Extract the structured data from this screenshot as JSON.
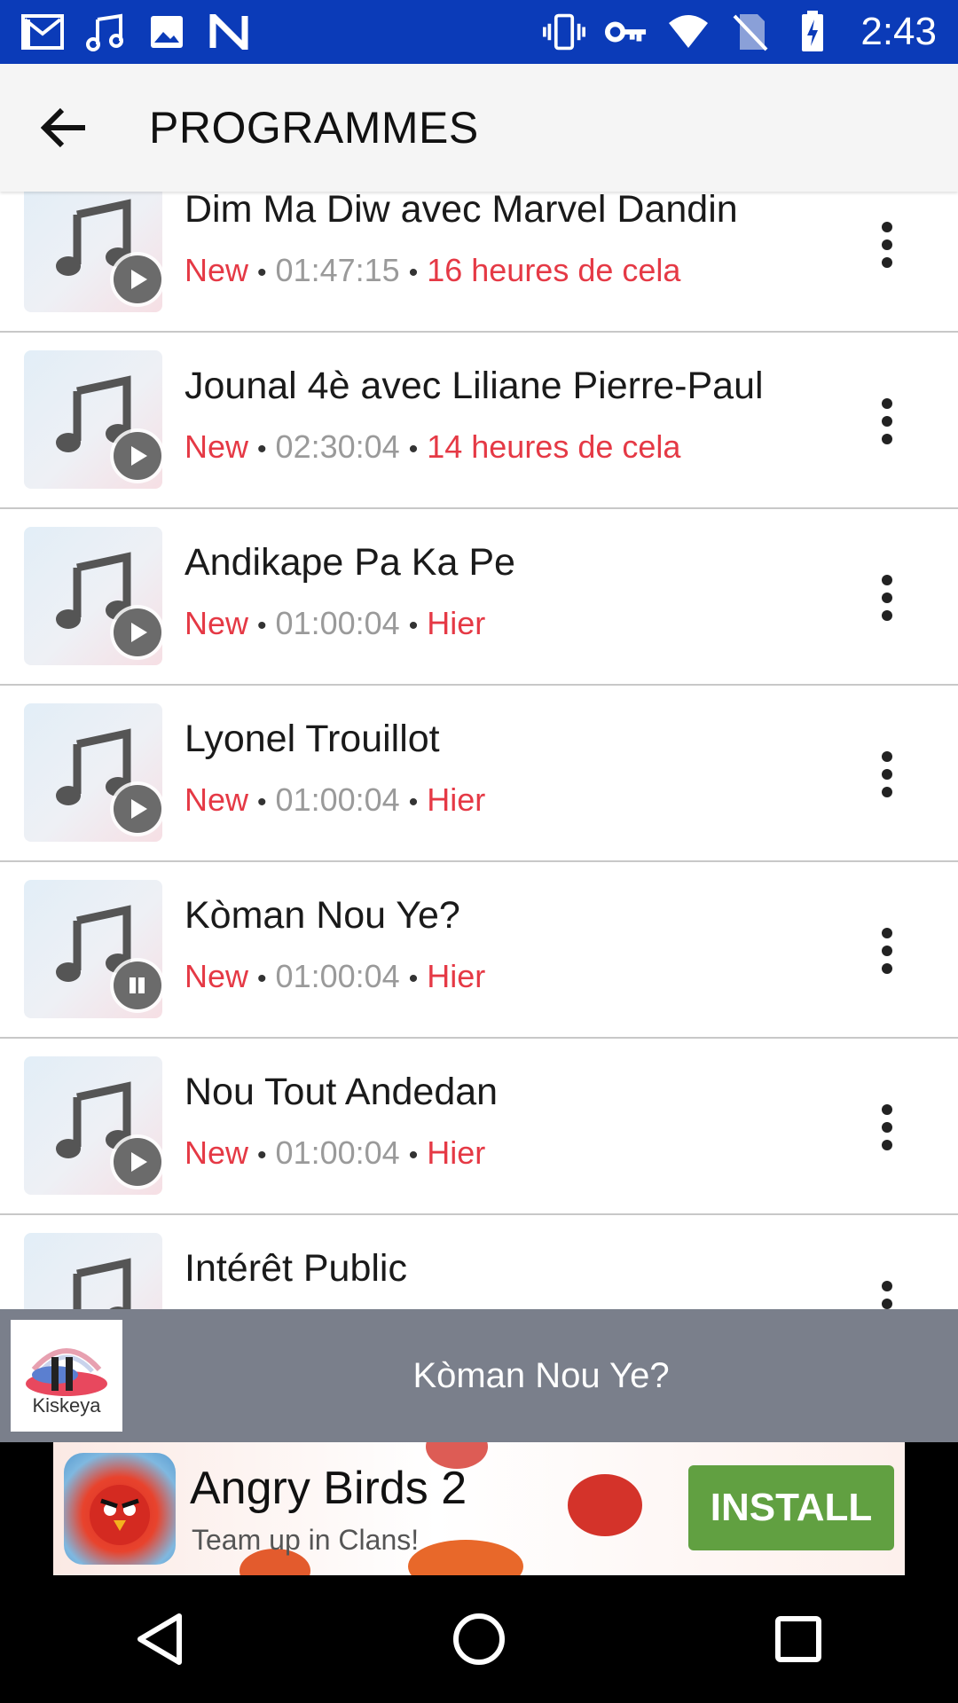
{
  "status_bar": {
    "time": "2:43",
    "left_icons": [
      "gmail-icon",
      "music-note-icon",
      "image-icon",
      "n-logo-icon"
    ],
    "right_icons": [
      "vibrate-icon",
      "vpn-key-icon",
      "wifi-icon",
      "no-sim-icon",
      "battery-charging-icon"
    ],
    "color": "#0b3bb8"
  },
  "app_bar": {
    "back_icon": "arrow-back-icon",
    "title": "PROGRAMMES"
  },
  "episodes": [
    {
      "title": "Dim Ma Diw avec Marvel Dandin",
      "badge": "New",
      "duration": "01:47:15",
      "when": "16 heures de cela",
      "state": "play"
    },
    {
      "title": "Jounal 4è avec Liliane Pierre-Paul",
      "badge": "New",
      "duration": "02:30:04",
      "when": "14 heures de cela",
      "state": "play"
    },
    {
      "title": "Andikape Pa Ka Pe",
      "badge": "New",
      "duration": "01:00:04",
      "when": "Hier",
      "state": "play"
    },
    {
      "title": "Lyonel Trouillot",
      "badge": "New",
      "duration": "01:00:04",
      "when": "Hier",
      "state": "play"
    },
    {
      "title": "Kòman Nou Ye?",
      "badge": "New",
      "duration": "01:00:04",
      "when": "Hier",
      "state": "pause"
    },
    {
      "title": "Nou Tout Andedan",
      "badge": "New",
      "duration": "01:00:04",
      "when": "Hier",
      "state": "play"
    },
    {
      "title": "Intérêt Public",
      "badge": "",
      "duration": "",
      "when": "",
      "state": "play"
    }
  ],
  "separator": "•",
  "mini_player": {
    "now_playing": "Kòman Nou Ye?",
    "art_label": "Kiskeya",
    "background": "#7a7f8b"
  },
  "ad": {
    "title": "Angry Birds 2",
    "subtitle": "Team up in Clans!",
    "cta": "INSTALL",
    "cta_color": "#61a041"
  },
  "nav_bar": {
    "buttons": [
      "back-triangle-icon",
      "home-circle-icon",
      "recents-square-icon"
    ]
  },
  "colors": {
    "accent_red": "#e53945",
    "duration_gray": "#9a9a9a"
  }
}
